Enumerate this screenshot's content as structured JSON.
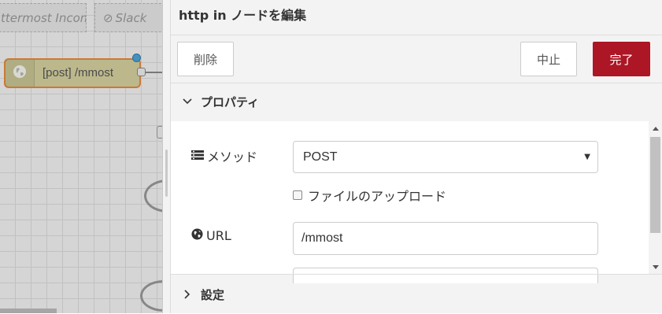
{
  "canvas": {
    "tabs": [
      {
        "label": "ttermost Incom"
      },
      {
        "label": "Slack",
        "icon": "disabled-circle-icon"
      }
    ],
    "node": {
      "label": "[post] /mmost",
      "icon": "globe-icon",
      "color": "#d6d2a0",
      "border_color": "#e68a3f"
    }
  },
  "tray": {
    "title": "http in ノードを編集",
    "buttons": {
      "delete": "削除",
      "cancel": "中止",
      "done": "完了"
    },
    "accent_color": "#ad1625",
    "sections": {
      "properties": "プロパティ",
      "settings": "設定"
    },
    "form": {
      "method_label": "メソッド",
      "method_icon": "tasks-icon",
      "method_value": "POST",
      "upload_label": "ファイルのアップロード",
      "upload_checked": false,
      "url_label": "URL",
      "url_icon": "globe-icon",
      "url_value": "/mmost"
    }
  }
}
